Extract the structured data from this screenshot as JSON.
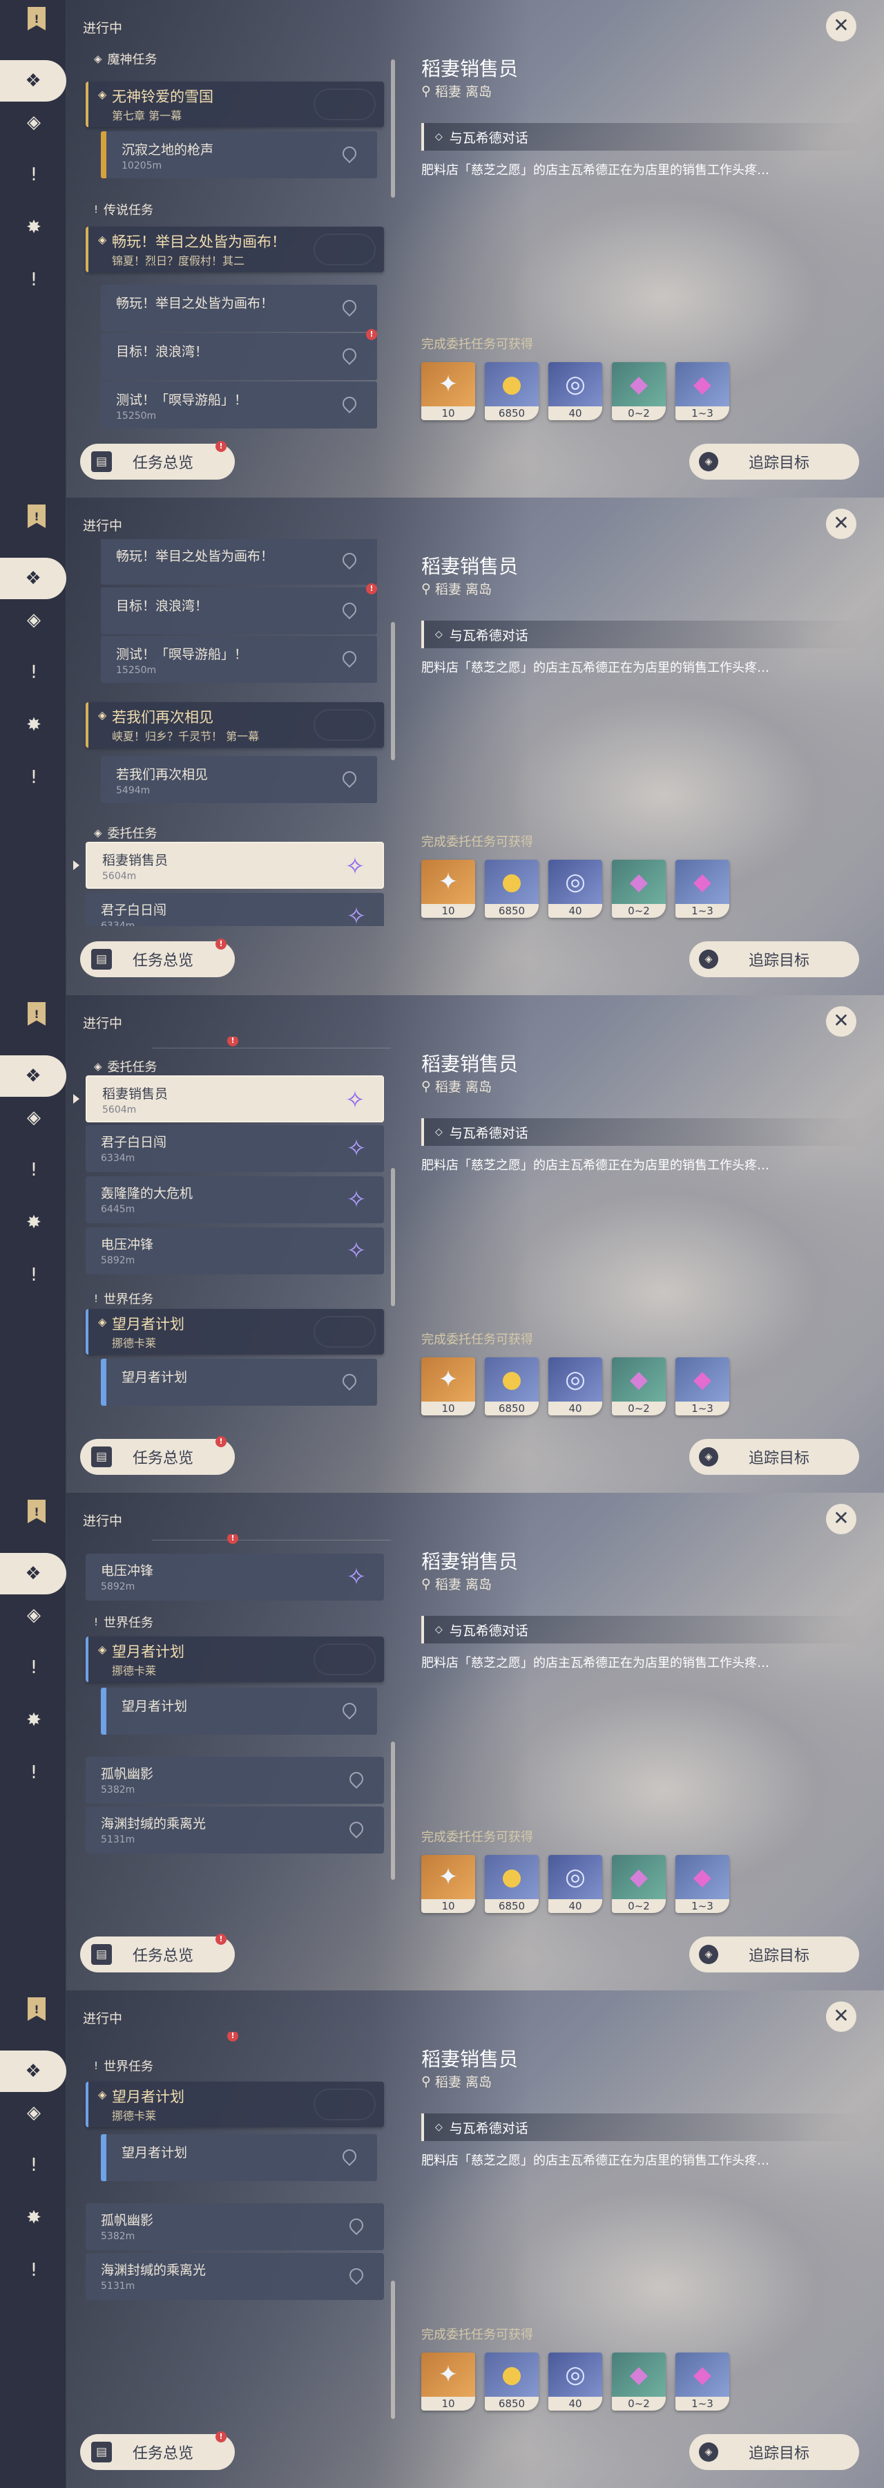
{
  "ui": {
    "status": "进行中",
    "overview_label": "任务总览",
    "track_label": "追踪目标",
    "close_glyph": "✕",
    "alert_glyph": "!"
  },
  "rail_icons": [
    "diamond-cluster-icon",
    "diamond-icon",
    "exclamation-icon",
    "star-diamond-icon",
    "exclamation-icon"
  ],
  "categories": {
    "archon": "魔神任务",
    "legend": "传说任务",
    "commission": "委托任务",
    "world": "世界任务"
  },
  "quests": {
    "archon_main": {
      "title": "无神铃爱的雪国",
      "subtitle": "第七章 第一幕"
    },
    "archon_step": {
      "title": "沉寂之地的枪声",
      "distance": "10205m"
    },
    "legend1_main": {
      "title": "畅玩！举目之处皆为画布！",
      "subtitle": "锦夏！烈日？度假村！其二"
    },
    "legend1_step1": {
      "title": "畅玩！举目之处皆为画布！"
    },
    "legend1_step2": {
      "title": "目标！浪浪湾！"
    },
    "legend1_step3": {
      "title": "测试！「暝导游船」！",
      "distance": "15250m"
    },
    "legend2_main": {
      "title": "若我们再次相见",
      "subtitle": "峡夏！归乡？千灵节！ 第一幕"
    },
    "legend2_step": {
      "title": "若我们再次相见",
      "distance": "5494m"
    },
    "comm1": {
      "title": "稻妻销售员",
      "distance": "5604m"
    },
    "comm2": {
      "title": "君子白日闯",
      "distance": "6334m"
    },
    "comm3": {
      "title": "轰隆隆的大危机",
      "distance": "6445m"
    },
    "comm4": {
      "title": "电压冲锋",
      "distance": "5892m"
    },
    "world_main": {
      "title": "望月者计划",
      "subtitle": "挪德卡莱"
    },
    "world_step": {
      "title": "望月者计划"
    },
    "world2": {
      "title": "孤帆幽影",
      "distance": "5382m"
    },
    "world3": {
      "title": "海渊封缄的乘离光",
      "distance": "5131m"
    },
    "partial1": "5494m",
    "partial2": "6445m"
  },
  "detail": {
    "title": "稻妻销售员",
    "location": "稻妻 离岛",
    "step": "与瓦希德对话",
    "description": "肥料店「慈芝之愿」的店主瓦希德正在为店里的销售工作头疼…",
    "rewards_label": "完成委托任务可获得"
  },
  "rewards": [
    {
      "icon": "primogem-icon",
      "glyph": "✦",
      "value": "10"
    },
    {
      "icon": "mora-icon",
      "glyph": "●",
      "value": "6850"
    },
    {
      "icon": "exp-book-icon",
      "glyph": "◎",
      "value": "40"
    },
    {
      "icon": "crystal-ore-icon",
      "glyph": "◆",
      "value": "0~2"
    },
    {
      "icon": "crystal-cluster-icon",
      "glyph": "◆",
      "value": "1~3"
    }
  ],
  "colors": {
    "accent": "#ece5d8",
    "gold": "#d6b25a",
    "alert": "#d8484a",
    "world": "#6fa2e8",
    "commission_icon": "#b49cff"
  }
}
